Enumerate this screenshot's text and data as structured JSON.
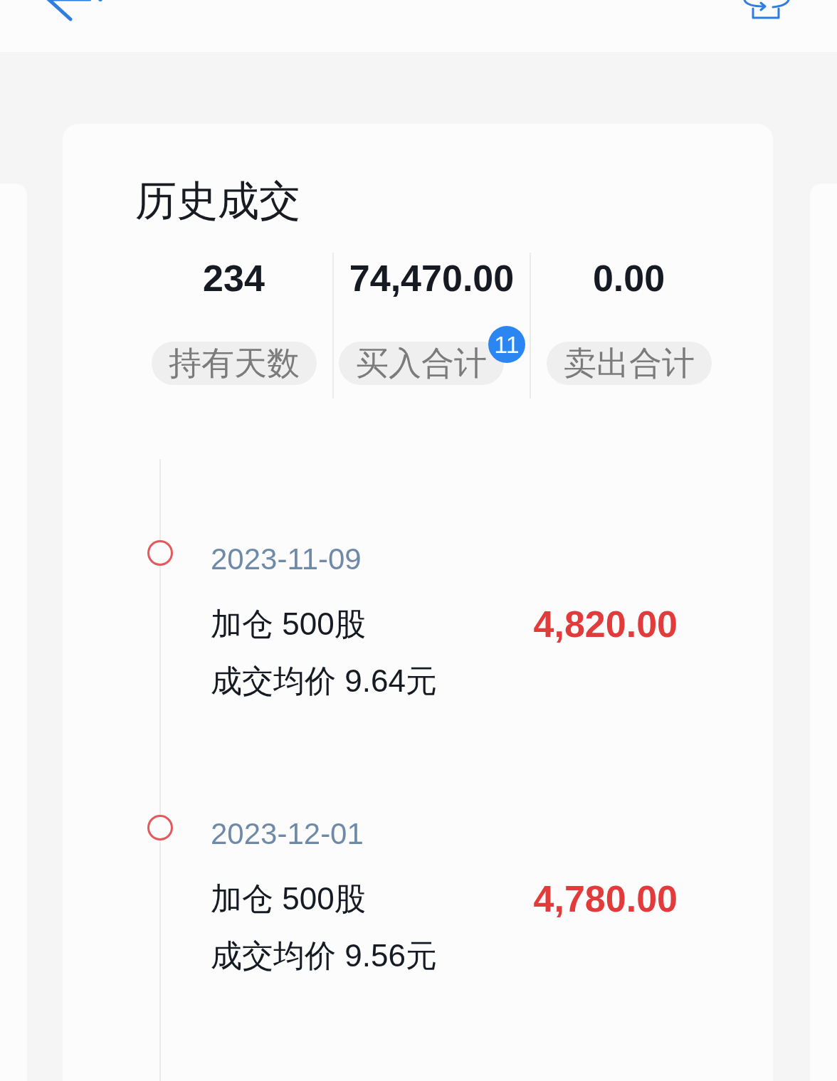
{
  "card": {
    "title": "历史成交",
    "stats": [
      {
        "value": "234",
        "label": "持有天数"
      },
      {
        "value": "74,470.00",
        "label": "买入合计",
        "badge": "11"
      },
      {
        "value": "0.00",
        "label": "卖出合计"
      }
    ]
  },
  "timeline": [
    {
      "date": "2023-11-09",
      "action": "加仓 500股",
      "amount": "4,820.00",
      "avg_price": "成交均价 9.64元"
    },
    {
      "date": "2023-12-01",
      "action": "加仓 500股",
      "amount": "4,780.00",
      "avg_price": "成交均价 9.56元"
    }
  ]
}
